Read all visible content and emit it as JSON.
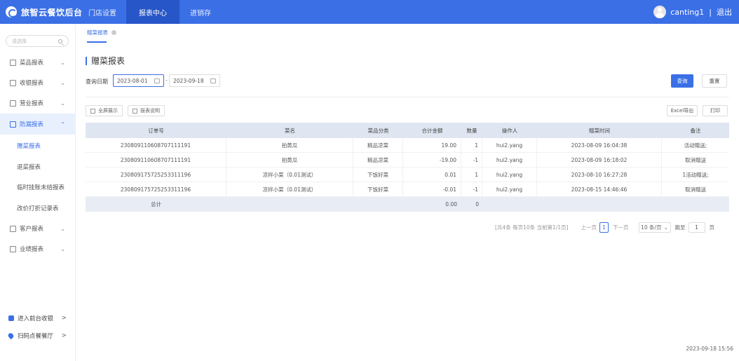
{
  "app": {
    "title": "旅智云餐饮后台"
  },
  "topnav": [
    "门店设置",
    "报表中心",
    "进销存"
  ],
  "user": {
    "name": "canting1",
    "separator": "|",
    "logout": "退出"
  },
  "sidebar": {
    "search_placeholder": "请选择",
    "menu": [
      {
        "label": "菜品报表",
        "icon": "dish-report-icon"
      },
      {
        "label": "收银报表",
        "icon": "cashier-report-icon"
      },
      {
        "label": "营业报表",
        "icon": "business-report-icon"
      },
      {
        "label": "防漏报表",
        "icon": "leak-report-icon"
      }
    ],
    "submenu": [
      "赠菜报表",
      "退菜报表",
      "临时挂账未结报表",
      "改价打折记录表"
    ],
    "menu2": [
      {
        "label": "客户报表",
        "icon": "customer-report-icon"
      },
      {
        "label": "业绩报表",
        "icon": "performance-report-icon"
      }
    ],
    "bottom": [
      {
        "label": "进入前台收银",
        "arrow": ">"
      },
      {
        "label": "扫码点餐餐厅",
        "arrow": ">"
      }
    ]
  },
  "tabs": [
    {
      "label": "赠菜报表"
    }
  ],
  "page": {
    "title": "赠菜报表",
    "filter_label": "查询日期",
    "date_from": "2023-08-01",
    "date_to": "2023-09-18",
    "dash": "-",
    "query_button": "查询",
    "reset_button": "重置",
    "fullscreen_button": "全屏展示",
    "report_desc_button": "报表说明",
    "excel_button": "Excel导出",
    "print_button": "打印"
  },
  "table": {
    "columns": [
      "订单号",
      "菜名",
      "菜品分类",
      "合计金额",
      "数量",
      "操作人",
      "赠菜时间",
      "备注"
    ],
    "rows": [
      [
        "230809110608707111191",
        "拍黄瓜",
        "精品凉菜",
        "19.00",
        "1",
        "hui2.yang",
        "2023-08-09 16:04:38",
        "活动赠送;"
      ],
      [
        "230809110608707111191",
        "拍黄瓜",
        "精品凉菜",
        "-19.00",
        "-1",
        "hui2.yang",
        "2023-08-09 16:18:02",
        "取消赠送"
      ],
      [
        "230809175725253311196",
        "凉拌小菜（0.01测试）",
        "下饭好菜",
        "0.01",
        "1",
        "hui2.yang",
        "2023-08-10 16:27:28",
        "1活动赠送;"
      ],
      [
        "230809175725253311196",
        "凉拌小菜（0.01测试）",
        "下饭好菜",
        "-0.01",
        "-1",
        "hui2.yang",
        "2023-08-15 14:46:46",
        "取消赠送"
      ]
    ],
    "total": {
      "label": "总计",
      "amount": "0.00",
      "qty": "0"
    }
  },
  "pagination": {
    "summary": "[共4条 每页10条 当前第1/1页]",
    "prev": "上一页",
    "current_page": "1",
    "next": "下一页",
    "page_size": "10 条/页",
    "goto_label": "跳至",
    "goto_value": "1",
    "page_unit": "页"
  },
  "footer": {
    "datetime": "2023-09-18 15:56"
  },
  "colors": {
    "primary": "#3a6fe6",
    "topbar": "#3a6fe6",
    "table_head": "#dfe6f1"
  }
}
